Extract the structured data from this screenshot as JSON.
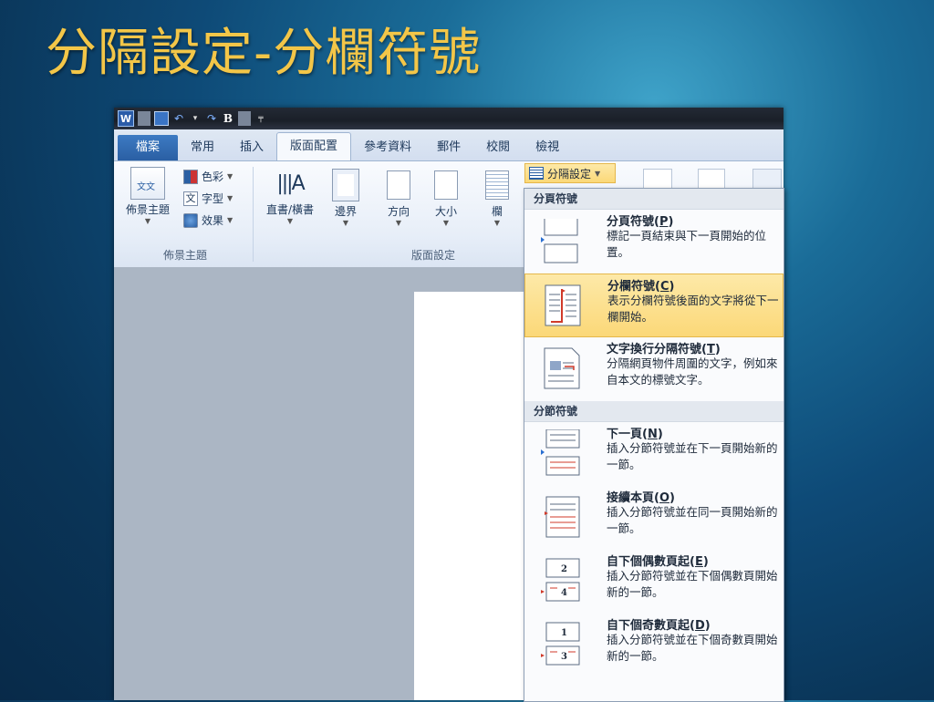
{
  "slide": {
    "title": "分隔設定-分欄符號"
  },
  "qat": {
    "word_icon": "W",
    "bold": "B",
    "undo_glyph": "↶",
    "redo_glyph": "↷",
    "caret": "▾",
    "customize": "╤"
  },
  "tabs": [
    "檔案",
    "常用",
    "插入",
    "版面配置",
    "參考資料",
    "郵件",
    "校閱",
    "檢視"
  ],
  "ribbon": {
    "themes": {
      "label": "佈景主題",
      "btn": "佈景主題",
      "colors": "色彩",
      "fonts": "字型",
      "effects": "效果",
      "icon_text": "文文"
    },
    "page_setup": {
      "label": "版面設定",
      "direction": "直書/橫書",
      "margins": "邊界",
      "orientation": "方向",
      "size": "大小",
      "columns": "欄"
    },
    "breaks_button": "分隔設定"
  },
  "menu": {
    "page_breaks_header": "分頁符號",
    "section_breaks_header": "分節符號",
    "items": [
      {
        "title": "分頁符號(",
        "key": "P",
        "title_end": ")",
        "desc": "標記一頁結束與下一頁開始的位置。"
      },
      {
        "title": "分欄符號(",
        "key": "C",
        "title_end": ")",
        "desc": "表示分欄符號後面的文字將從下一欄開始。"
      },
      {
        "title": "文字換行分隔符號(",
        "key": "T",
        "title_end": ")",
        "desc": "分隔網頁物件周圍的文字，例如來自本文的標號文字。"
      },
      {
        "title": "下一頁(",
        "key": "N",
        "title_end": ")",
        "desc": "插入分節符號並在下一頁開始新的一節。"
      },
      {
        "title": "接續本頁(",
        "key": "O",
        "title_end": ")",
        "desc": "插入分節符號並在同一頁開始新的一節。"
      },
      {
        "title": "自下個偶數頁起(",
        "key": "E",
        "title_end": ")",
        "desc": "插入分節符號並在下個偶數頁開始新的一節。"
      },
      {
        "title": "自下個奇數頁起(",
        "key": "D",
        "title_end": ")",
        "desc": "插入分節符號並在下個奇數頁開始新的一節。"
      }
    ],
    "even_num": "2",
    "even_num2": "4",
    "odd_num": "1",
    "odd_num2": "3"
  },
  "colors": {
    "highlight": "#fbd878",
    "title": "#f3c648",
    "file_tab": "#2a5fa3"
  }
}
